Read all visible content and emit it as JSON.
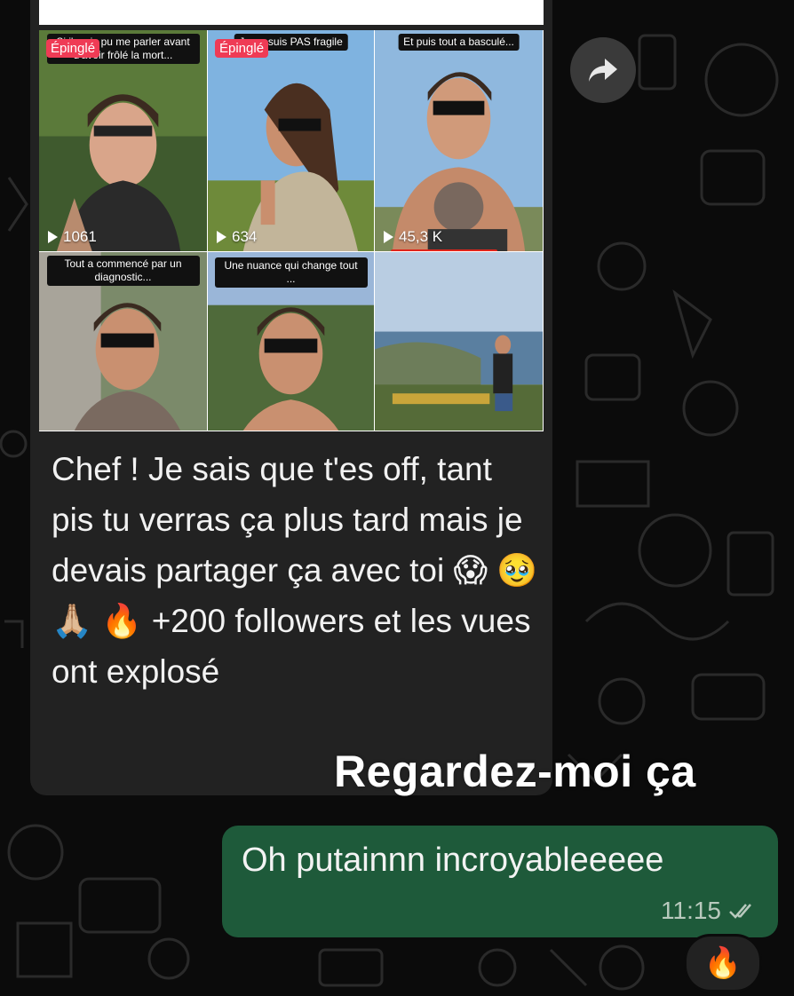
{
  "chat": {
    "incoming": {
      "tiktok_grid": [
        {
          "caption": "Si j'avais pu me parler avant d'avoir frôlé la mort...",
          "badge": "Épinglé",
          "views": "1061"
        },
        {
          "caption": "Je ne suis PAS fragile",
          "badge": "Épinglé",
          "views": "634"
        },
        {
          "caption": "Et puis tout a basculé...",
          "badge": "",
          "views": "45,3 K"
        },
        {
          "caption": "Tout a commencé par un diagnostic...",
          "badge": "",
          "views": ""
        },
        {
          "caption": "Une nuance qui change tout ...",
          "badge": "",
          "views": ""
        },
        {
          "caption": "",
          "badge": "",
          "views": ""
        }
      ],
      "message": "Chef ! Je sais que t'es off, tant pis tu verras ça plus tard mais je devais partager ça avec toi 😱 🥹 🙏🏼 🔥 +200 followers et les vues ont explosé"
    },
    "story_overlay": "Regardez-moi ça",
    "outgoing": {
      "message": "Oh putainnn incroyableeeee",
      "time": "11:15",
      "status_icon": "double-check-icon"
    },
    "reaction": "🔥"
  },
  "colors": {
    "incoming_bubble": "#222222",
    "outgoing_bubble": "#1e5a3a",
    "pin_badge": "#ef3b55",
    "highlight_underline": "#e0251b"
  }
}
